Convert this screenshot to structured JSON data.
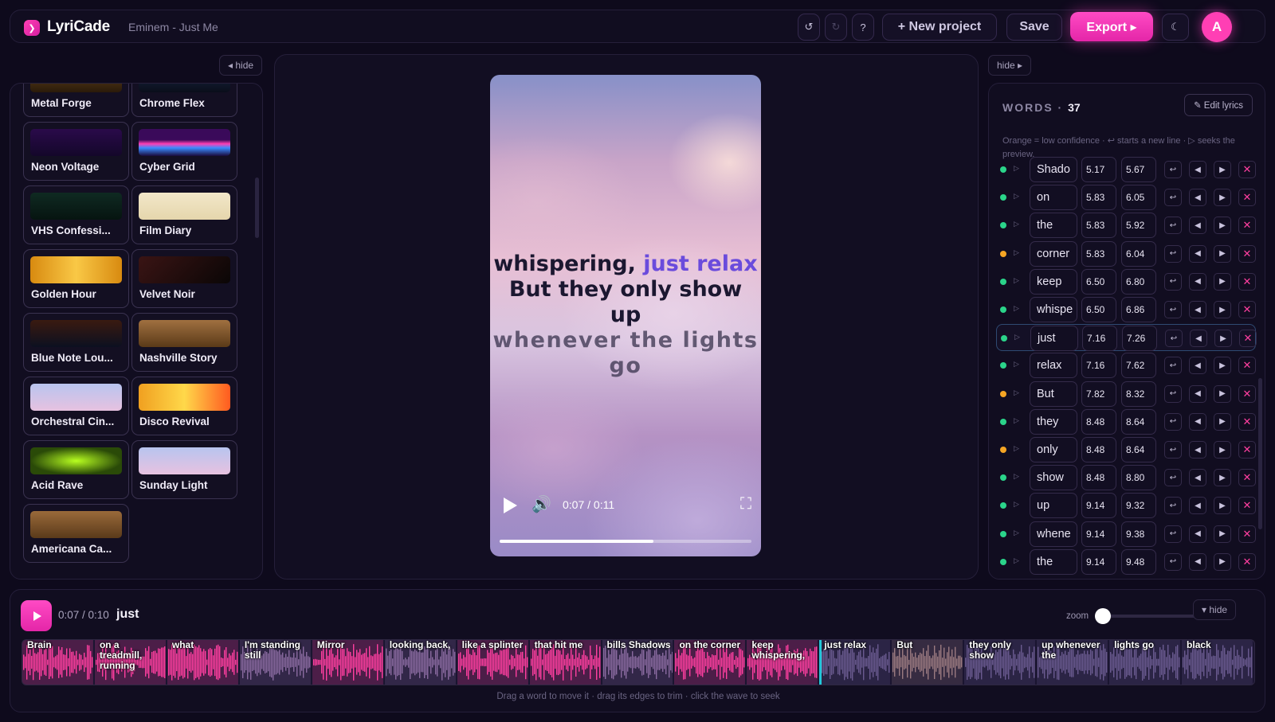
{
  "app": {
    "name": "LyriCade",
    "project": "Eminem - Just Me"
  },
  "toolbar": {
    "undo_icon": "↺",
    "redo_icon": "↻",
    "help_label": "?",
    "new_project_label": "+ New project",
    "save_label": "Save",
    "export_label": "Export ▸",
    "theme_toggle_icon": "☾",
    "avatar_initial": "A"
  },
  "left_panel": {
    "hide_label": "◂ hide",
    "themes": [
      {
        "name": "Metal Forge",
        "thumb": "linear-gradient(180deg,#6b4a1e,#2a1a0a)"
      },
      {
        "name": "Chrome Flex",
        "thumb": "linear-gradient(180deg,#1b2a4a,#0a0e1a)"
      },
      {
        "name": "Neon Voltage",
        "thumb": "linear-gradient(180deg,#2a0a4a,#14072a)"
      },
      {
        "name": "Cyber Grid",
        "thumb": "linear-gradient(180deg,#3a0a5a 40%,#ff3fb4 55%,#3a8bff 70%,#1a0a3a)"
      },
      {
        "name": "VHS Confessi...",
        "thumb": "linear-gradient(180deg,#0f2a22,#061410)"
      },
      {
        "name": "Film Diary",
        "thumb": "linear-gradient(180deg,#f2e7c9,#e5d6ac)"
      },
      {
        "name": "Golden Hour",
        "thumb": "linear-gradient(90deg,#d88a10,#f9c846,#d88a10)"
      },
      {
        "name": "Velvet Noir",
        "thumb": "linear-gradient(135deg,#3a1414,#0a0606)"
      },
      {
        "name": "Blue Note Lou...",
        "thumb": "linear-gradient(180deg,#3a1a10,#0c1020)"
      },
      {
        "name": "Nashville Story",
        "thumb": "linear-gradient(180deg,#a07040,#5a3a18)"
      },
      {
        "name": "Orchestral Cin...",
        "thumb": "linear-gradient(180deg,#b8c4ef,#e7c2e0)"
      },
      {
        "name": "Disco Revival",
        "thumb": "linear-gradient(90deg,#f0a020,#ffd84a,#ff5a20)"
      },
      {
        "name": "Acid Rave",
        "thumb": "radial-gradient(ellipse at center,#b8ff20,#2a4a08 70%)"
      },
      {
        "name": "Sunday Light",
        "thumb": "linear-gradient(180deg,#b8c4ef,#e7c2e0)"
      },
      {
        "name": "Americana Ca...",
        "thumb": "linear-gradient(180deg,#9a6a3a,#5a3a1a)"
      }
    ]
  },
  "preview": {
    "lyric_plain_1": "whispering, ",
    "lyric_highlight": "just relax",
    "lyric_plain_2": " But they only show up",
    "lyric_dim": "whenever the lights go",
    "time": "0:07 / 0:11",
    "progress": 0.61,
    "play_icon": "play-icon",
    "volume_icon": "🔊",
    "fullscreen_icon": "⛶"
  },
  "words_panel": {
    "hide_label": "hide ▸",
    "title": "WORDS · ",
    "count": "37",
    "edit_label": "✎ Edit lyrics",
    "hint": "Orange = low confidence · ↩ starts a new line · ▷ seeks the preview.",
    "colors": {
      "ok": "#2bd48a",
      "low": "#f5a524"
    },
    "rows": [
      {
        "word": "Shado",
        "start": "5.17",
        "end": "5.67",
        "conf": "ok"
      },
      {
        "word": "on",
        "start": "5.83",
        "end": "6.05",
        "conf": "ok"
      },
      {
        "word": "the",
        "start": "5.83",
        "end": "5.92",
        "conf": "ok"
      },
      {
        "word": "corner",
        "start": "5.83",
        "end": "6.04",
        "conf": "low"
      },
      {
        "word": "keep",
        "start": "6.50",
        "end": "6.80",
        "conf": "ok"
      },
      {
        "word": "whispe",
        "start": "6.50",
        "end": "6.86",
        "conf": "ok"
      },
      {
        "word": "just",
        "start": "7.16",
        "end": "7.26",
        "conf": "ok",
        "selected": true
      },
      {
        "word": "relax",
        "start": "7.16",
        "end": "7.62",
        "conf": "ok"
      },
      {
        "word": "But",
        "start": "7.82",
        "end": "8.32",
        "conf": "low"
      },
      {
        "word": "they",
        "start": "8.48",
        "end": "8.64",
        "conf": "ok"
      },
      {
        "word": "only",
        "start": "8.48",
        "end": "8.64",
        "conf": "low"
      },
      {
        "word": "show",
        "start": "8.48",
        "end": "8.80",
        "conf": "ok"
      },
      {
        "word": "up",
        "start": "9.14",
        "end": "9.32",
        "conf": "ok"
      },
      {
        "word": "whene",
        "start": "9.14",
        "end": "9.38",
        "conf": "ok"
      },
      {
        "word": "the",
        "start": "9.14",
        "end": "9.48",
        "conf": "ok"
      }
    ]
  },
  "timeline": {
    "time": "0:07 / 0:10",
    "current_word": "just",
    "zoom_label": "zoom",
    "hide_label": "▾ hide",
    "hint": "Drag a word to move it · drag its edges to trim · click the wave to seek",
    "clips": [
      {
        "label": "Brain",
        "color": "#ff3fa0"
      },
      {
        "label": "on a treadmill, running",
        "color": "#ff3fa0"
      },
      {
        "label": "what",
        "color": "#ff3fa0"
      },
      {
        "label": "I'm standing still",
        "color": "#8a6aa0"
      },
      {
        "label": "Mirror",
        "color": "#ff3fa0"
      },
      {
        "label": "looking back,",
        "color": "#8a6aa0"
      },
      {
        "label": "like a splinter",
        "color": "#ff3fa0"
      },
      {
        "label": "that hit me",
        "color": "#ff3fa0"
      },
      {
        "label": "bills Shadows",
        "color": "#8a6aa0"
      },
      {
        "label": "on the corner",
        "color": "#ff3fa0"
      },
      {
        "label": "keep whispering,",
        "color": "#ff3fa0"
      },
      {
        "label": "just relax",
        "color": "#6a5a90"
      },
      {
        "label": "But",
        "color": "#9a7a80"
      },
      {
        "label": "they only show",
        "color": "#6a5a90"
      },
      {
        "label": "up whenever the",
        "color": "#6a5a90"
      },
      {
        "label": "lights go",
        "color": "#6a5a90"
      },
      {
        "label": "black",
        "color": "#6a5a90"
      }
    ]
  }
}
